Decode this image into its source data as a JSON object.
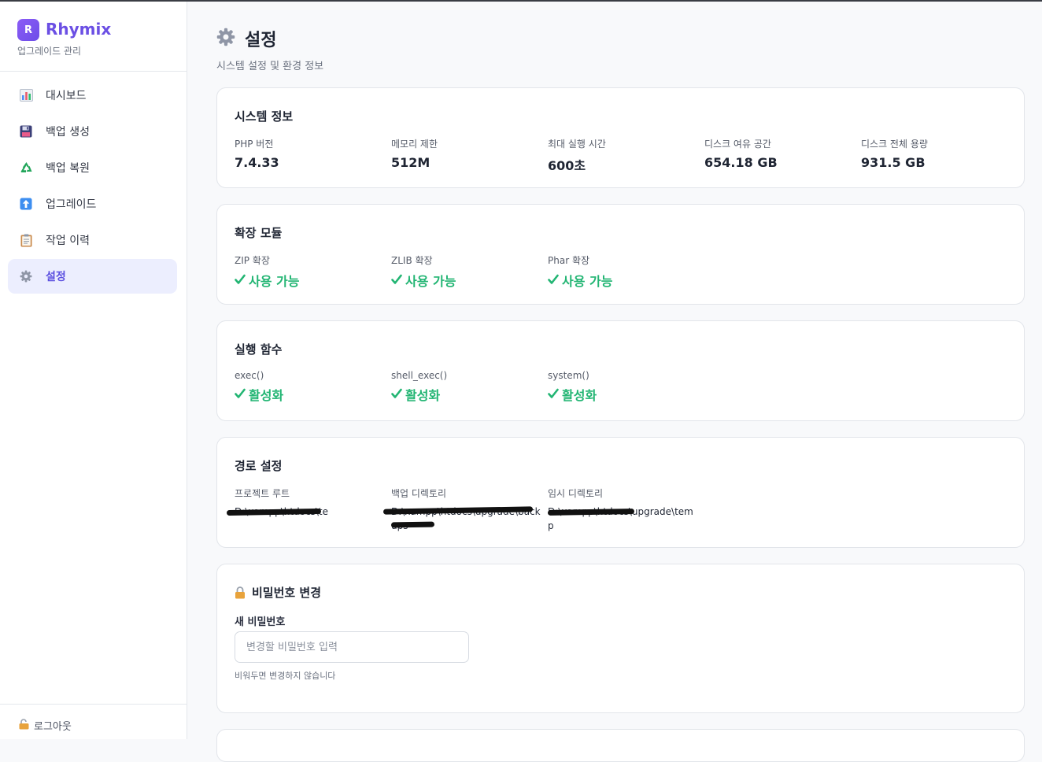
{
  "brand": {
    "logo_letter": "R",
    "name": "Rhymix",
    "subtitle": "업그레이드 관리"
  },
  "sidebar": {
    "items": [
      {
        "label": "대시보드",
        "icon": "bar-chart-icon",
        "active": false
      },
      {
        "label": "백업 생성",
        "icon": "floppy-disk-icon",
        "active": false
      },
      {
        "label": "백업 복원",
        "icon": "recycle-icon",
        "active": false
      },
      {
        "label": "업그레이드",
        "icon": "up-arrow-icon",
        "active": false
      },
      {
        "label": "작업 이력",
        "icon": "clipboard-icon",
        "active": false
      },
      {
        "label": "설정",
        "icon": "gear-icon",
        "active": true
      }
    ],
    "logout_label": "로그아웃"
  },
  "page": {
    "title": "설정",
    "subtitle": "시스템 설정 및 환경 정보"
  },
  "system_info": {
    "title": "시스템 정보",
    "fields": [
      {
        "label": "PHP 버전",
        "value": "7.4.33"
      },
      {
        "label": "메모리 제한",
        "value": "512M"
      },
      {
        "label": "최대 실행 시간",
        "value": "600초"
      },
      {
        "label": "디스크 여유 공간",
        "value": "654.18 GB"
      },
      {
        "label": "디스크 전체 용량",
        "value": "931.5 GB"
      }
    ]
  },
  "extensions": {
    "title": "확장 모듈",
    "fields": [
      {
        "label": "ZIP 확장",
        "value": "사용 가능"
      },
      {
        "label": "ZLIB 확장",
        "value": "사용 가능"
      },
      {
        "label": "Phar 확장",
        "value": "사용 가능"
      }
    ]
  },
  "exec_functions": {
    "title": "실행 함수",
    "fields": [
      {
        "label": "exec()",
        "value": "활성화"
      },
      {
        "label": "shell_exec()",
        "value": "활성화"
      },
      {
        "label": "system()",
        "value": "활성화"
      }
    ]
  },
  "paths": {
    "title": "경로 설정",
    "fields": [
      {
        "label": "프로젝트 루트",
        "value": "D:\\xampp\\htdocs\\te"
      },
      {
        "label": "백업 디렉토리",
        "value": "D:\\xampp\\htdocs\\upgrade\\backups"
      },
      {
        "label": "임시 디렉토리",
        "value": "D:\\xampp\\htdocs\\upgrade\\temp"
      }
    ]
  },
  "password": {
    "title": "비밀번호 변경",
    "label": "새 비밀번호",
    "placeholder": "변경할 비밀번호 입력",
    "help": "비워두면 변경하지 않습니다"
  },
  "colors": {
    "accent": "#6b4fe4",
    "success": "#22b573",
    "active_bg": "#eceefe"
  }
}
